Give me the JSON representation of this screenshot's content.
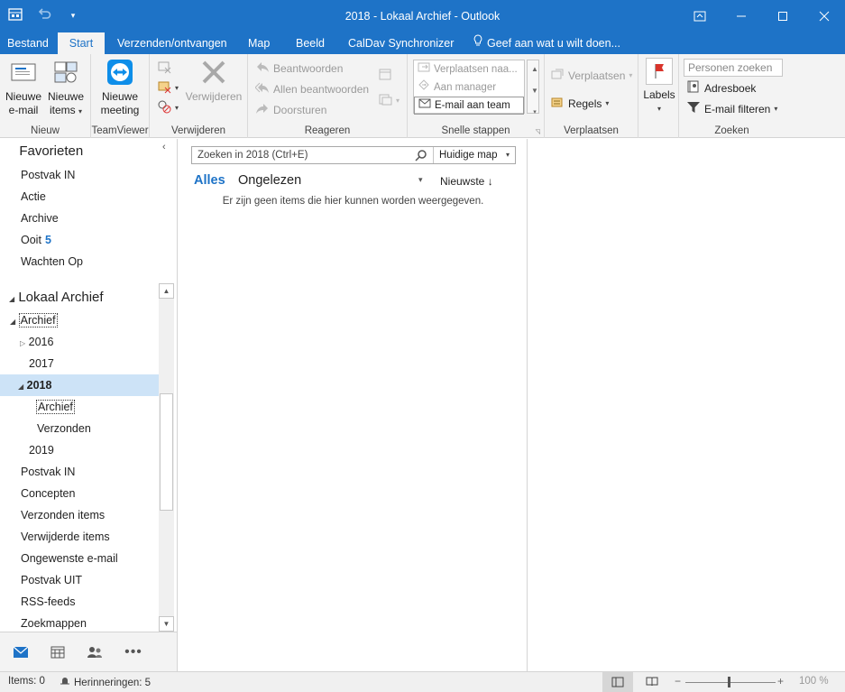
{
  "window": {
    "title": "2018 - Lokaal Archief - Outlook",
    "accent": "#1e73c7"
  },
  "tabs": [
    {
      "label": "Bestand"
    },
    {
      "label": "Start"
    },
    {
      "label": "Verzenden/ontvangen"
    },
    {
      "label": "Map"
    },
    {
      "label": "Beeld"
    },
    {
      "label": "CalDav Synchronizer"
    }
  ],
  "tell_me": "Geef aan wat u wilt doen...",
  "ribbon": {
    "new": {
      "group": "Nieuw",
      "new_email_l1": "Nieuwe",
      "new_email_l2": "e-mail",
      "new_items_l1": "Nieuwe",
      "new_items_l2": "items"
    },
    "teamviewer": {
      "group": "TeamViewer",
      "meeting_l1": "Nieuwe",
      "meeting_l2": "meeting"
    },
    "delete": {
      "group": "Verwijderen",
      "delete_label": "Verwijderen"
    },
    "respond": {
      "group": "Reageren",
      "reply": "Beantwoorden",
      "reply_all": "Allen beantwoorden",
      "forward": "Doorsturen"
    },
    "quicksteps": {
      "group": "Snelle stappen",
      "items": [
        "Verplaatsen naa...",
        "Aan manager",
        "E-mail aan team"
      ]
    },
    "move": {
      "group": "Verplaatsen",
      "move": "Verplaatsen",
      "rules": "Regels"
    },
    "tags": {
      "labels": "Labels"
    },
    "find": {
      "group": "Zoeken",
      "people_placeholder": "Personen zoeken",
      "address_book": "Adresboek",
      "filter_email": "E-mail filteren"
    }
  },
  "nav": {
    "favorites_header": "Favorieten",
    "favorites": [
      {
        "label": "Postvak IN"
      },
      {
        "label": "Actie"
      },
      {
        "label": "Archive"
      },
      {
        "label": "Ooit",
        "count": "5"
      },
      {
        "label": "Wachten Op"
      }
    ],
    "archive_header": "Lokaal Archief",
    "tree": [
      {
        "label": "Archief"
      },
      {
        "label": "2016"
      },
      {
        "label": "2017"
      },
      {
        "label": "2018"
      },
      {
        "label": "Archief"
      },
      {
        "label": "Verzonden"
      },
      {
        "label": "2019"
      },
      {
        "label": "Postvak IN"
      },
      {
        "label": "Concepten"
      },
      {
        "label": "Verzonden items"
      },
      {
        "label": "Verwijderde items"
      },
      {
        "label": "Ongewenste e-mail"
      },
      {
        "label": "Postvak UIT"
      },
      {
        "label": "RSS-feeds"
      },
      {
        "label": "Zoekmappen"
      }
    ]
  },
  "list": {
    "search_placeholder": "Zoeken in 2018 (Ctrl+E)",
    "scope": "Huidige map",
    "filter_all": "Alles",
    "filter_unread": "Ongelezen",
    "sort": "Nieuwste",
    "empty_message": "Er zijn geen items die hier kunnen worden weergegeven."
  },
  "status": {
    "items": "Items: 0",
    "reminders": "Herinneringen: 5",
    "zoom": "100 %"
  }
}
